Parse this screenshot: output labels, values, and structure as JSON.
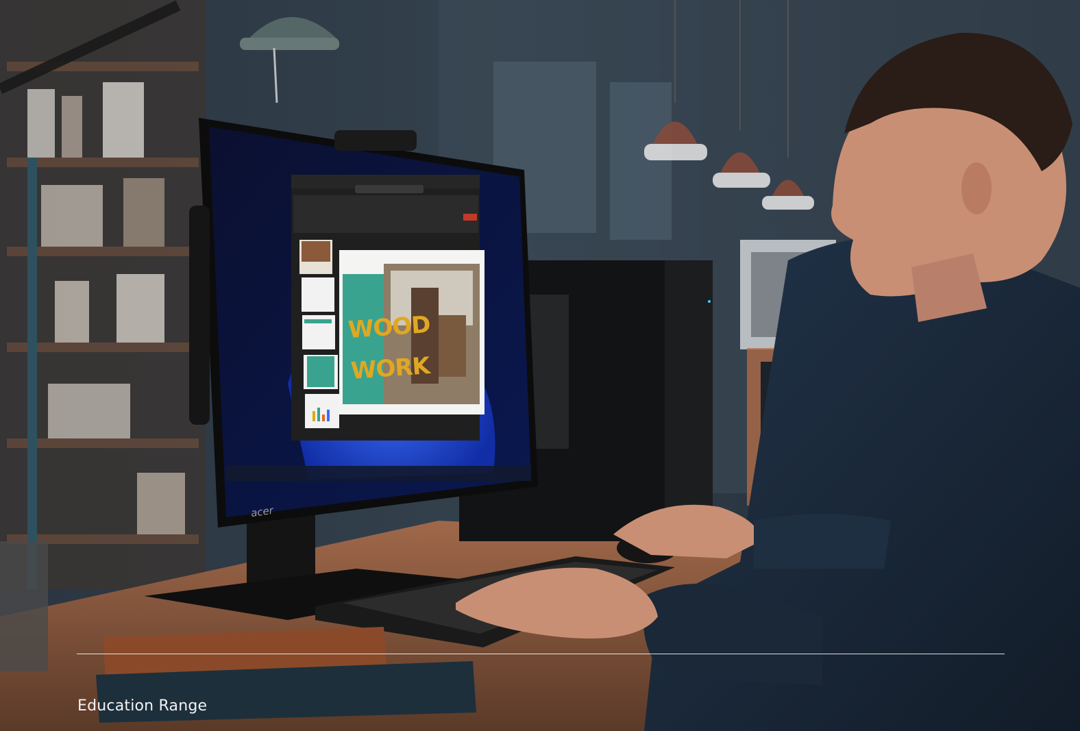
{
  "caption": {
    "label": "Education Range"
  },
  "slide": {
    "title_line1": "WOOD",
    "title_line2": "WORK"
  },
  "monitor": {
    "brand_label": "acer"
  },
  "colors": {
    "slide_title": "#e0a822",
    "slide_panel": "#3aa38f",
    "wallpaper_blue": "#1a3fd6",
    "app_ribbon": "#2b2b2b",
    "accent_red": "#c0392b"
  }
}
